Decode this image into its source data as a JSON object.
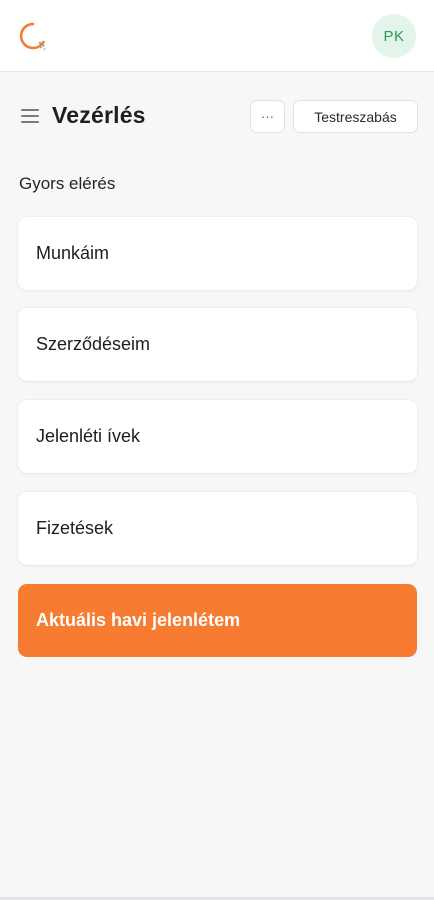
{
  "topbar": {
    "logo_icon": "app-logo-icon",
    "avatar_initials": "PK",
    "avatar_colors": {
      "background": "#e3f4ea",
      "text": "#2a9a5a"
    }
  },
  "header": {
    "menu_icon": "hamburger-menu-icon",
    "title": "Vezérlés",
    "more_label": "···",
    "customize_label": "Testreszabás"
  },
  "quick_access": {
    "title": "Gyors elérés",
    "items": [
      {
        "label": "Munkáim"
      },
      {
        "label": "Szerződéseim"
      },
      {
        "label": "Jelenléti ívek"
      },
      {
        "label": "Fizetések"
      },
      {
        "label": "Aktuális havi jelenlétem",
        "highlight": true
      }
    ]
  },
  "colors": {
    "accent": "#f77b30",
    "page_background": "#f7f7f8",
    "card_background": "#ffffff"
  }
}
